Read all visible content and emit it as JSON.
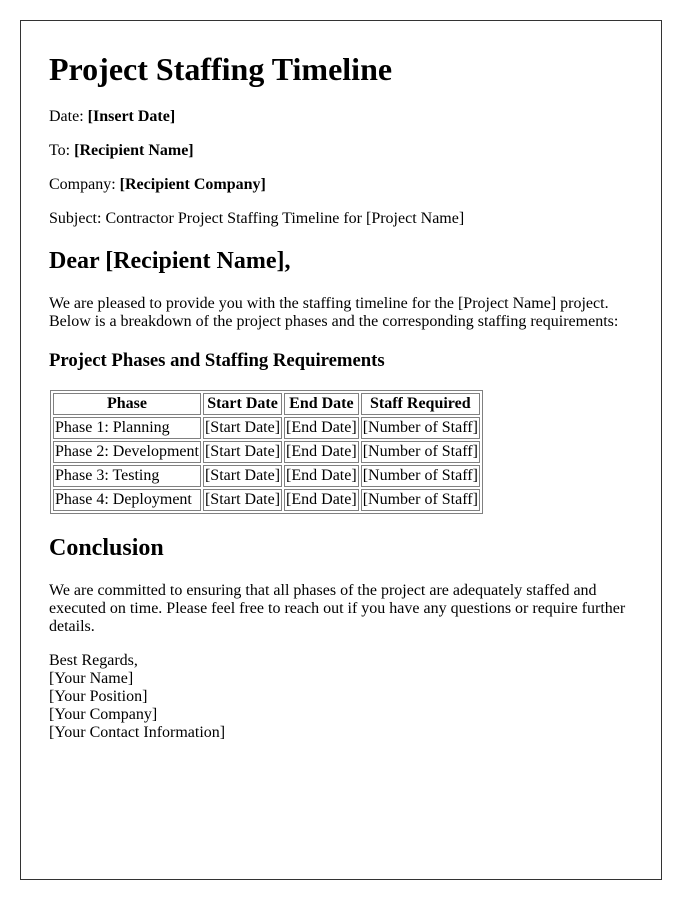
{
  "document": {
    "title": "Project Staffing Timeline",
    "meta": [
      {
        "label": "Date:",
        "value": "[Insert Date]",
        "bold_value": true
      },
      {
        "label": "To:",
        "value": "[Recipient Name]",
        "bold_value": true
      },
      {
        "label": "Company:",
        "value": "[Recipient Company]",
        "bold_value": true
      },
      {
        "label": "Subject:",
        "value": "Contractor Project Staffing Timeline for [Project Name]",
        "bold_value": false
      }
    ],
    "greeting": "Dear [Recipient Name],",
    "intro": "We are pleased to provide you with the staffing timeline for the [Project Name] project. Below is a breakdown of the project phases and the corresponding staffing requirements:",
    "table_heading": "Project Phases and Staffing Requirements",
    "table": {
      "headers": [
        "Phase",
        "Start Date",
        "End Date",
        "Staff Required"
      ],
      "rows": [
        [
          "Phase 1: Planning",
          "[Start Date]",
          "[End Date]",
          "[Number of Staff]"
        ],
        [
          "Phase 2: Development",
          "[Start Date]",
          "[End Date]",
          "[Number of Staff]"
        ],
        [
          "Phase 3: Testing",
          "[Start Date]",
          "[End Date]",
          "[Number of Staff]"
        ],
        [
          "Phase 4: Deployment",
          "[Start Date]",
          "[End Date]",
          "[Number of Staff]"
        ]
      ]
    },
    "conclusion_heading": "Conclusion",
    "conclusion": "We are committed to ensuring that all phases of the project are adequately staffed and executed on time. Please feel free to reach out if you have any questions or require further details.",
    "signature": [
      "Best Regards,",
      "[Your Name]",
      "[Your Position]",
      "[Your Company]",
      "[Your Contact Information]"
    ]
  }
}
